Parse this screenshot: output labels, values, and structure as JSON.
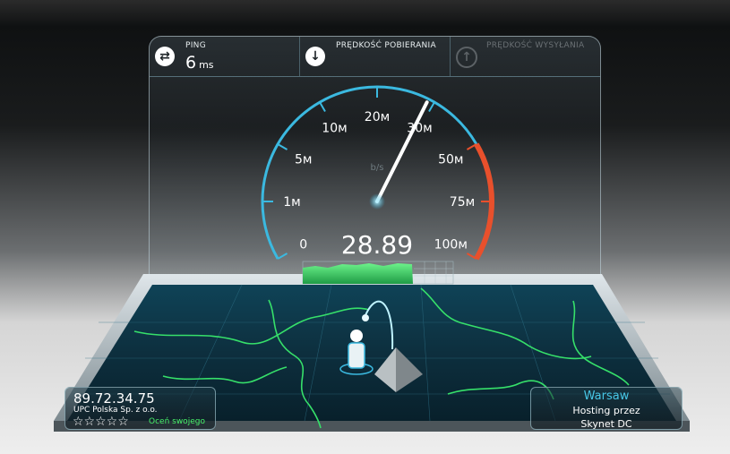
{
  "ping": {
    "label": "PING",
    "value": "6",
    "unit": "ms",
    "icon": "ping-icon"
  },
  "download": {
    "label": "PRĘDKOŚĆ POBIERANIA",
    "icon": "download-arrow-icon"
  },
  "upload": {
    "label": "PRĘDKOŚĆ WYSYŁANIA",
    "icon": "upload-arrow-icon"
  },
  "gauge": {
    "unit_label": "b/s",
    "ticks": [
      "0",
      "1м",
      "5м",
      "10м",
      "20м",
      "30м",
      "50м",
      "75м",
      "100м"
    ],
    "reading": "28.89",
    "reading_value": 28.89,
    "accent": "#3bb9e0",
    "warn": "#e8502c"
  },
  "client": {
    "ip": "89.72.34.75",
    "isp": "UPC Polska Sp. z o.o.",
    "stars": "☆☆☆☆☆",
    "rate_label": "Oceń swojego"
  },
  "server": {
    "city": "Warsaw",
    "line1": "Hosting przez",
    "line2": "Skynet DC"
  }
}
